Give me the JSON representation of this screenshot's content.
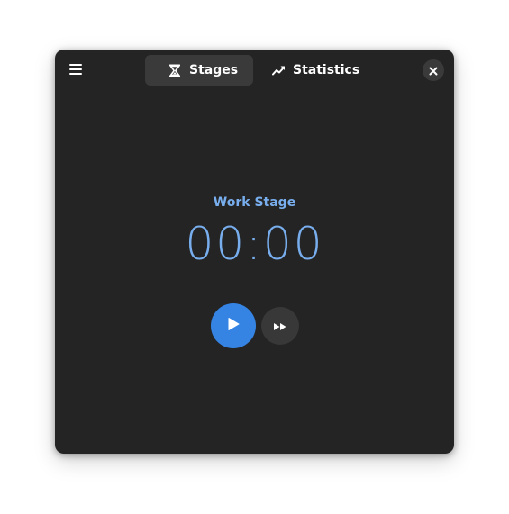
{
  "header": {
    "menu_icon": "hamburger-menu-icon",
    "tabs": [
      {
        "label": "Stages",
        "icon": "hourglass-icon",
        "active": true
      },
      {
        "label": "Statistics",
        "icon": "trend-up-icon",
        "active": false
      }
    ],
    "close_icon": "close-icon"
  },
  "main": {
    "stage_label": "Work Stage",
    "timer": "00:00"
  },
  "controls": {
    "play_icon": "play-icon",
    "skip_icon": "skip-forward-icon"
  },
  "colors": {
    "window_bg": "#242424",
    "accent_text": "#78aeed",
    "accent_button": "#3584e4",
    "tab_active_bg": "#3a3a3a"
  }
}
